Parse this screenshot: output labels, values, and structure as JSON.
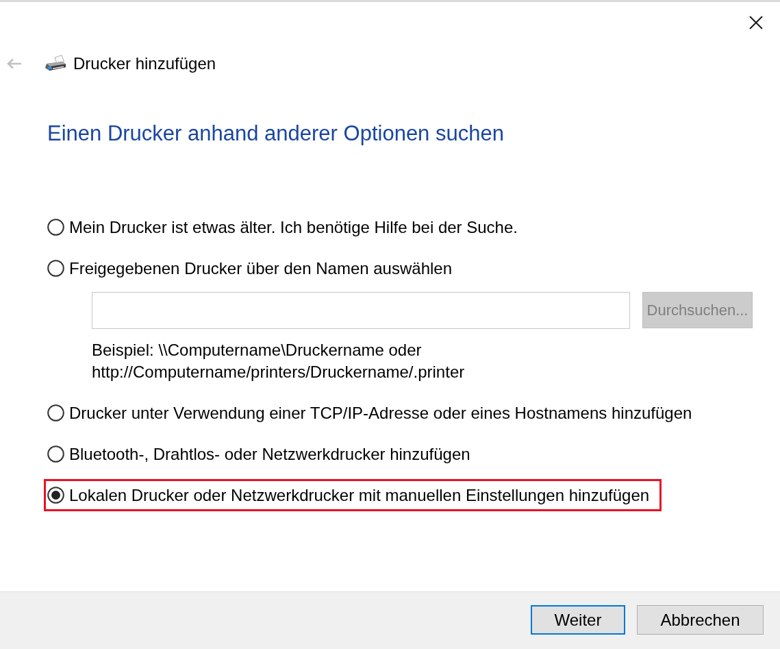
{
  "back_button": {
    "disabled": true
  },
  "window": {
    "title": "Drucker hinzufügen"
  },
  "heading": "Einen Drucker anhand anderer Optionen suchen",
  "options": [
    {
      "label": "Mein Drucker ist etwas älter. Ich benötige Hilfe bei der Suche.",
      "selected": false,
      "highlighted": false
    },
    {
      "label": "Freigegebenen Drucker über den Namen auswählen",
      "selected": false,
      "highlighted": false,
      "name_input": {
        "browse_button": {
          "label": "Durchsuchen...",
          "disabled": true
        },
        "example": "Beispiel: \\\\Computername\\Druckername oder http://Computername/printers/Druckername/.printer"
      }
    },
    {
      "label": "Drucker unter Verwendung einer TCP/IP-Adresse oder eines Hostnamens hinzufügen",
      "selected": false,
      "highlighted": false
    },
    {
      "label": "Bluetooth-, Drahtlos- oder Netzwerkdrucker hinzufügen",
      "selected": false,
      "highlighted": false
    },
    {
      "label": "Lokalen Drucker oder Netzwerkdrucker mit manuellen Einstellungen hinzufügen",
      "selected": true,
      "highlighted": true
    }
  ],
  "buttons": [
    {
      "label": "Weiter",
      "default": true
    },
    {
      "label": "Abbrechen",
      "default": false
    }
  ]
}
